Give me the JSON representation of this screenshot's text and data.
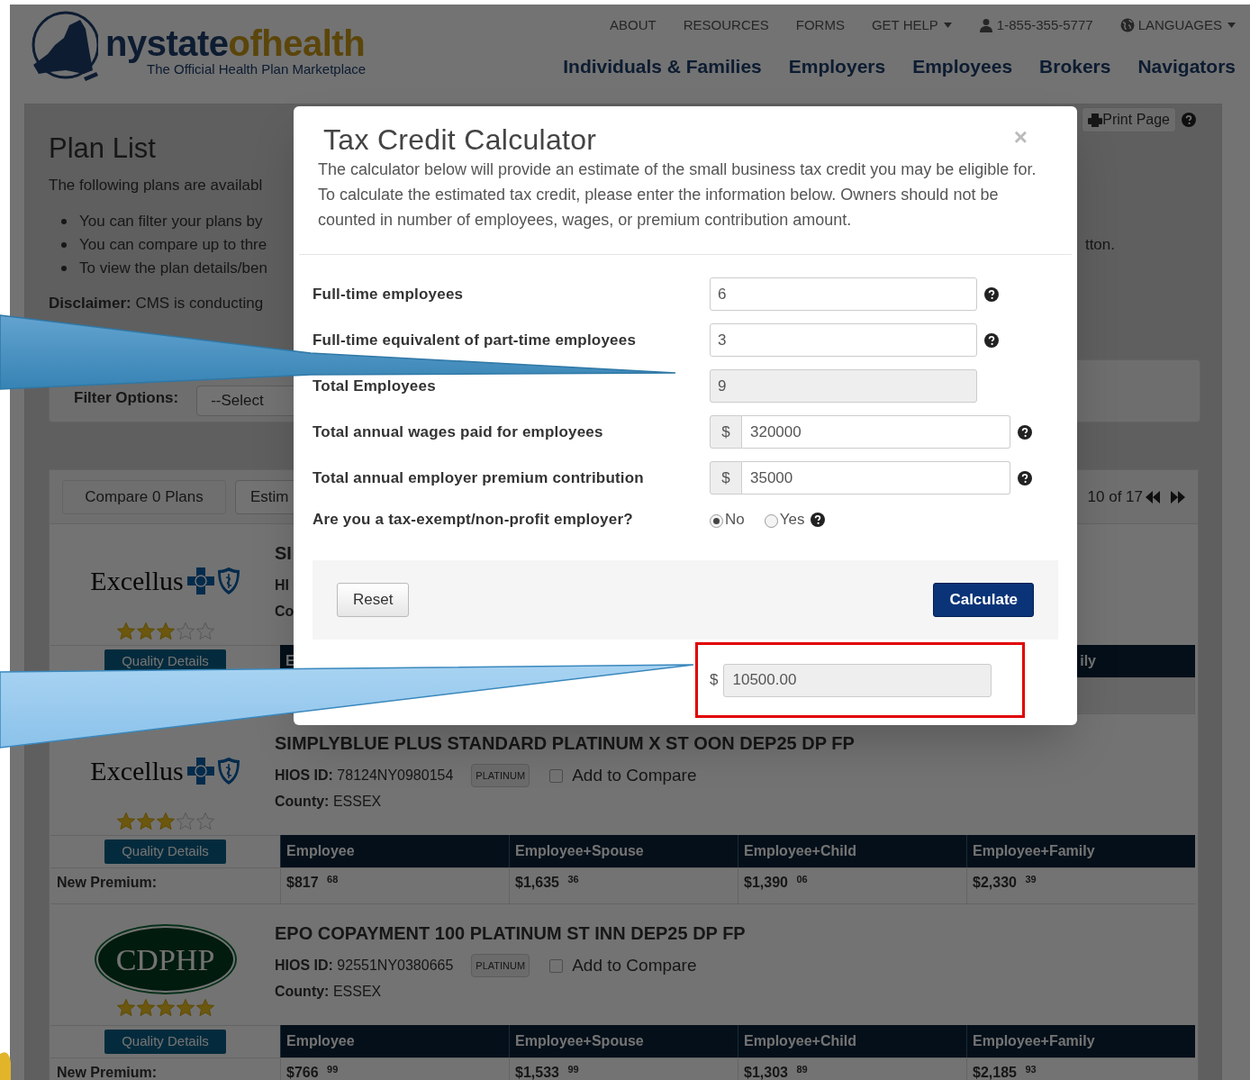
{
  "header": {
    "logo": {
      "part1": "nystate",
      "part2": "ofhealth",
      "tagline": "The Official Health Plan Marketplace"
    },
    "top_links": [
      {
        "label": "ABOUT",
        "kind": "link"
      },
      {
        "label": "RESOURCES",
        "kind": "link"
      },
      {
        "label": "FORMS",
        "kind": "link"
      },
      {
        "label": "GET HELP",
        "kind": "dropdown"
      },
      {
        "label": "1-855-355-5777",
        "kind": "phone"
      },
      {
        "label": "LANGUAGES",
        "kind": "language"
      }
    ],
    "main_nav": [
      "Individuals & Families",
      "Employers",
      "Employees",
      "Brokers",
      "Navigators"
    ]
  },
  "plan_list": {
    "title": "Plan List",
    "print_button": "Print Page",
    "intro": "The following plans are availabl",
    "bullets": [
      "You can filter your plans by",
      "You can compare up to thre",
      "To view the plan details/ben"
    ],
    "bullet_tail": "tton.",
    "disclaimer": "**Disclaimer:** CMS is conducting",
    "filter_label": "Filter Options:",
    "filter_select": "--Select"
  },
  "results": {
    "compare_button": {
      "label": "Compare 0 Plans",
      "disabled": true
    },
    "estimate_button": "Estim",
    "pager": "10 of 17",
    "plans": [
      {
        "kind": "covered",
        "logo": {
          "kind": "excellus",
          "text": "Excellus"
        },
        "stars": 3,
        "quality_button": "Quality Details",
        "title": "SI",
        "hios": "HI",
        "county": "Co",
        "columns": [
          "E",
          "ily"
        ]
      },
      {
        "kind": "full",
        "logo": {
          "kind": "excellus",
          "text": "Excellus"
        },
        "stars": 3,
        "quality_button": "Quality Details",
        "title": "SIMPLYBLUE PLUS STANDARD PLATINUM X ST OON DEP25 DP FP",
        "hios": "**HIOS ID:** 78124NY0980154",
        "tier": "PLATINUM",
        "compare": {
          "label": "Add to Compare",
          "checked": false
        },
        "county": "**County:** ESSEX",
        "columns": [
          "Employee",
          "Employee+Spouse",
          "Employee+Child",
          "Employee+Family"
        ],
        "premium_label": "New Premium:",
        "premiums": [
          "$817 $^{68}$",
          "$1,635 $^{36}$",
          "$1,390 $^{06}$",
          "$2,330 $^{39}$"
        ]
      },
      {
        "kind": "full",
        "logo": {
          "kind": "cdphp",
          "text": "CDPHP"
        },
        "stars": 5,
        "quality_button": "Quality Details",
        "title": "EPO COPAYMENT 100 PLATINUM ST INN DEP25 DP FP",
        "hios": "**HIOS ID:** 92551NY0380665",
        "tier": "PLATINUM",
        "compare": {
          "label": "Add to Compare",
          "checked": false
        },
        "county": "**County:** ESSEX",
        "columns": [
          "Employee",
          "Employee+Spouse",
          "Employee+Child",
          "Employee+Family"
        ],
        "premium_label": "New Premium:",
        "premiums": [
          "$766 $^{99}$",
          "$1,533 $^{99}$",
          "$1,303 $^{89}$",
          "$2,185 $^{93}$"
        ]
      }
    ]
  },
  "modal": {
    "title": "Tax Credit Calculator",
    "close": "×",
    "description": "The calculator below will provide an estimate of the small business tax credit you may be eligible for. To calculate the estimated tax credit, please enter the information below. Owners should not be counted in number of employees, wages, or premium contribution amount.",
    "fields": [
      {
        "kind": "number",
        "label": "Full-time employees",
        "value": "6",
        "help": true
      },
      {
        "kind": "number",
        "label": "Full-time equivalent of part-time employees",
        "value": "3",
        "help": true
      },
      {
        "kind": "readonly",
        "label": "Total Employees",
        "value": "9",
        "help": false
      },
      {
        "kind": "currency",
        "label": "Total annual wages paid for employees",
        "currency": "$",
        "value": "320000",
        "help": true
      },
      {
        "kind": "currency",
        "label": "Total annual employer premium contribution",
        "currency": "$",
        "value": "35000",
        "help": true
      },
      {
        "kind": "radio",
        "label": "Are you a tax-exempt/non-profit employer?",
        "options": [
          {
            "label": "No",
            "selected": true
          },
          {
            "label": "Yes",
            "selected": false
          }
        ],
        "help": true
      }
    ],
    "reset_button": "Reset",
    "calculate_button": "Calculate",
    "result": {
      "currency": "$",
      "value": "10500.00",
      "highlighted": true
    }
  }
}
